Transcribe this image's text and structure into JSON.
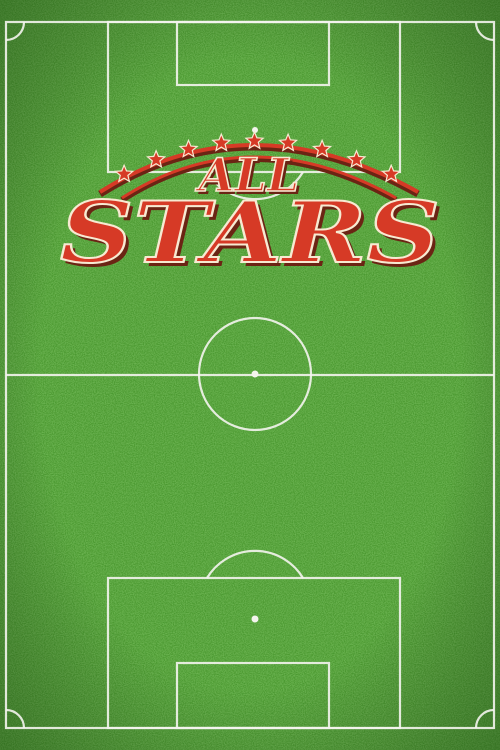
{
  "title": {
    "line1": "ALL",
    "line2": "STARS"
  },
  "colors": {
    "grass_light": "#58a93a",
    "grass_dark": "#3a8421",
    "line": "#f4f4ee",
    "logo_red": "#d63a26",
    "logo_outline": "#f7ead2",
    "logo_shadow": "#6b2414"
  },
  "logo": {
    "star_icon": "star-icon",
    "star_count": 9
  }
}
